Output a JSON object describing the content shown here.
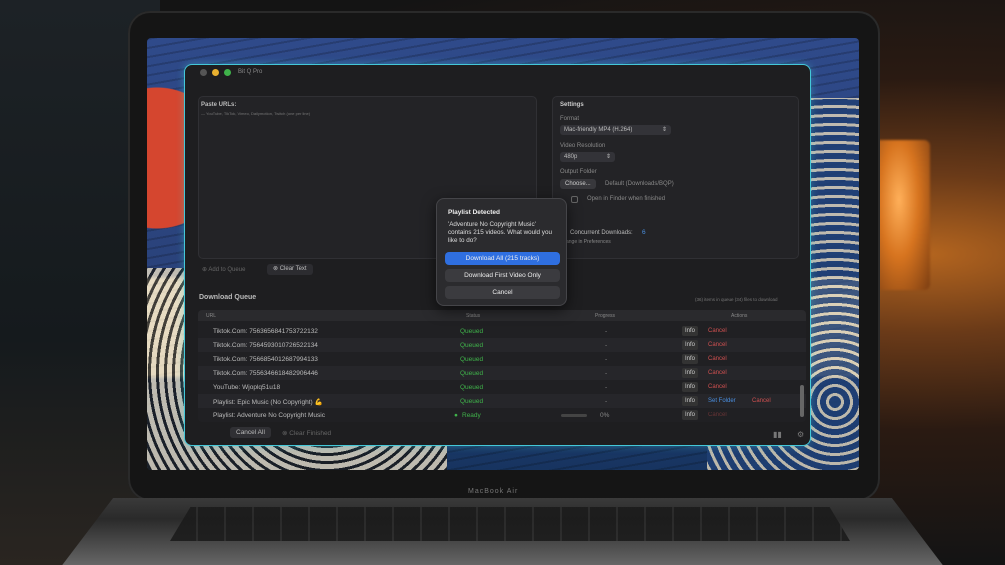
{
  "window": {
    "title": "Bit Q Pro"
  },
  "paste": {
    "title": "Paste URLs:",
    "hint": "— YouTube, TikTok, Vimeo, Dailymotion, Twitch (one per line)"
  },
  "settings": {
    "title": "Settings",
    "format_label": "Format",
    "format_value": "Mac-friendly MP4 (H.264)",
    "resolution_label": "Video Resolution",
    "resolution_value": "480p",
    "output_label": "Output Folder",
    "choose_label": "Choose...",
    "output_value": "Default (Downloads/BQP)",
    "open_finder_label": "Open in Finder when finished",
    "concurrent_label": "Concurrent Downloads:",
    "concurrent_value": "6",
    "prefs_hint": "ange in Preferences"
  },
  "actions": {
    "add_to_queue": "Add to Queue",
    "clear_text": "Clear Text"
  },
  "queue": {
    "title": "Download Queue",
    "stats": "(36) items in queue   (34) files to download",
    "columns": {
      "url": "URL",
      "status": "Status",
      "progress": "Progress",
      "actions": "Actions"
    },
    "rows": [
      {
        "url": "Tiktok.Com: 7563656841753722132",
        "status": "Queued",
        "progress": "-",
        "info": "Info",
        "cancel": "Cancel"
      },
      {
        "url": "Tiktok.Com: 7564593010726522134",
        "status": "Queued",
        "progress": "-",
        "info": "Info",
        "cancel": "Cancel"
      },
      {
        "url": "Tiktok.Com: 7566854012687994133",
        "status": "Queued",
        "progress": "-",
        "info": "Info",
        "cancel": "Cancel"
      },
      {
        "url": "Tiktok.Com: 7556346618482906446",
        "status": "Queued",
        "progress": "-",
        "info": "Info",
        "cancel": "Cancel"
      },
      {
        "url": "YouTube: Wjoplq51u18",
        "status": "Queued",
        "progress": "-",
        "info": "Info",
        "cancel": "Cancel"
      },
      {
        "url": "Playlist: Epic Music (No Copyright) 💪",
        "status": "Queued",
        "progress": "-",
        "info": "Info",
        "setfolder": "Set Folder",
        "cancel": "Cancel"
      },
      {
        "url": "Playlist: Adventure No Copyright Music",
        "status": "Ready",
        "progress": "0%",
        "info": "Info",
        "cancel": "Cancel"
      }
    ],
    "cancel_all": "Cancel All",
    "clear_finished": "Clear Finished"
  },
  "dialog": {
    "title": "Playlist Detected",
    "message": "'Adventure No Copyright Music' contains 215 videos. What would you like to do?",
    "download_all": "Download All (215 tracks)",
    "download_first": "Download First Video Only",
    "cancel": "Cancel"
  },
  "device": {
    "brand": "MacBook Air"
  },
  "colors": {
    "accent_blue": "#2f6fe0",
    "status_green": "#3fb24a",
    "cancel_red": "#d05050",
    "window_border": "#44c8d8"
  }
}
